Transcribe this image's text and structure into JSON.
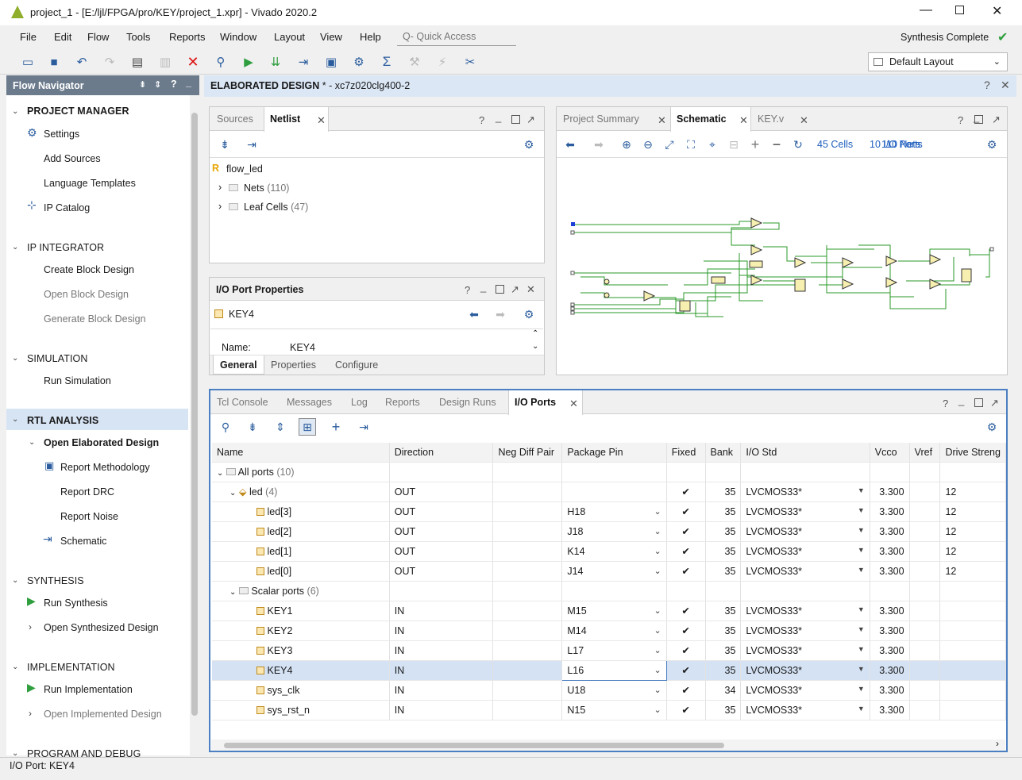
{
  "window": {
    "title": "project_1 - [E:/ljl/FPGA/pro/KEY/project_1.xpr] - Vivado 2020.2"
  },
  "menu": [
    "File",
    "Edit",
    "Flow",
    "Tools",
    "Reports",
    "Window",
    "Layout",
    "View",
    "Help"
  ],
  "quick_access_placeholder": "Q- Quick Access",
  "status_right": "Synthesis Complete",
  "layout_select": "Default Layout",
  "flow_navigator": {
    "title": "Flow Navigator",
    "sections": [
      {
        "title": "PROJECT MANAGER",
        "items": [
          "Settings",
          "Add Sources",
          "Language Templates",
          "IP Catalog"
        ]
      },
      {
        "title": "IP INTEGRATOR",
        "items": [
          "Create Block Design",
          "Open Block Design",
          "Generate Block Design"
        ]
      },
      {
        "title": "SIMULATION",
        "items": [
          "Run Simulation"
        ]
      },
      {
        "title": "RTL ANALYSIS",
        "items": [
          "Open Elaborated Design",
          "Report Methodology",
          "Report DRC",
          "Report Noise",
          "Schematic"
        ]
      },
      {
        "title": "SYNTHESIS",
        "items": [
          "Run Synthesis",
          "Open Synthesized Design"
        ]
      },
      {
        "title": "IMPLEMENTATION",
        "items": [
          "Run Implementation",
          "Open Implemented Design"
        ]
      },
      {
        "title": "PROGRAM AND DEBUG",
        "items": []
      }
    ]
  },
  "design_header": {
    "title": "ELABORATED DESIGN",
    "part": " * - xc7z020clg400-2"
  },
  "sources_panel": {
    "tabs": [
      "Sources",
      "Netlist"
    ],
    "top": "flow_led",
    "nodes": [
      {
        "label": "Nets",
        "count": "(110)"
      },
      {
        "label": "Leaf Cells",
        "count": "(47)"
      }
    ]
  },
  "port_props": {
    "title": "I/O Port Properties",
    "object": "KEY4",
    "name_label": "Name:",
    "name_value": "KEY4",
    "tabs": [
      "General",
      "Properties",
      "Configure"
    ]
  },
  "schematic_panel": {
    "tabs": [
      "Project Summary",
      "Schematic",
      "KEY.v"
    ],
    "cells": "45 Cells",
    "ports": "10 I/O Ports",
    "nets": "110 Nets"
  },
  "bottom_panel": {
    "tabs": [
      "Tcl Console",
      "Messages",
      "Log",
      "Reports",
      "Design Runs",
      "I/O Ports"
    ],
    "columns": [
      "Name",
      "Direction",
      "Neg Diff Pair",
      "Package Pin",
      "Fixed",
      "Bank",
      "I/O Std",
      "Vcco",
      "Vref",
      "Drive Streng"
    ],
    "all_ports": {
      "label": "All ports",
      "count": "(10)"
    },
    "groups": [
      {
        "label": "led",
        "count": "(4)",
        "direction": "OUT",
        "fixed": "✔",
        "bank": "35",
        "iostd": "LVCMOS33*",
        "vcco": "3.300",
        "drive": "12",
        "rows": [
          {
            "name": "led[3]",
            "dir": "OUT",
            "pin": "H18",
            "fixed": "✔",
            "bank": "35",
            "iostd": "LVCMOS33*",
            "vcco": "3.300",
            "drive": "12"
          },
          {
            "name": "led[2]",
            "dir": "OUT",
            "pin": "J18",
            "fixed": "✔",
            "bank": "35",
            "iostd": "LVCMOS33*",
            "vcco": "3.300",
            "drive": "12"
          },
          {
            "name": "led[1]",
            "dir": "OUT",
            "pin": "K14",
            "fixed": "✔",
            "bank": "35",
            "iostd": "LVCMOS33*",
            "vcco": "3.300",
            "drive": "12"
          },
          {
            "name": "led[0]",
            "dir": "OUT",
            "pin": "J14",
            "fixed": "✔",
            "bank": "35",
            "iostd": "LVCMOS33*",
            "vcco": "3.300",
            "drive": "12"
          }
        ]
      },
      {
        "label": "Scalar ports",
        "count": "(6)",
        "rows": [
          {
            "name": "KEY1",
            "dir": "IN",
            "pin": "M15",
            "fixed": "✔",
            "bank": "35",
            "iostd": "LVCMOS33*",
            "vcco": "3.300",
            "drive": ""
          },
          {
            "name": "KEY2",
            "dir": "IN",
            "pin": "M14",
            "fixed": "✔",
            "bank": "35",
            "iostd": "LVCMOS33*",
            "vcco": "3.300",
            "drive": ""
          },
          {
            "name": "KEY3",
            "dir": "IN",
            "pin": "L17",
            "fixed": "✔",
            "bank": "35",
            "iostd": "LVCMOS33*",
            "vcco": "3.300",
            "drive": ""
          },
          {
            "name": "KEY4",
            "dir": "IN",
            "pin": "L16",
            "fixed": "✔",
            "bank": "35",
            "iostd": "LVCMOS33*",
            "vcco": "3.300",
            "drive": ""
          },
          {
            "name": "sys_clk",
            "dir": "IN",
            "pin": "U18",
            "fixed": "✔",
            "bank": "34",
            "iostd": "LVCMOS33*",
            "vcco": "3.300",
            "drive": ""
          },
          {
            "name": "sys_rst_n",
            "dir": "IN",
            "pin": "N15",
            "fixed": "✔",
            "bank": "35",
            "iostd": "LVCMOS33*",
            "vcco": "3.300",
            "drive": ""
          }
        ]
      }
    ]
  },
  "statusbar": "I/O Port: KEY4"
}
